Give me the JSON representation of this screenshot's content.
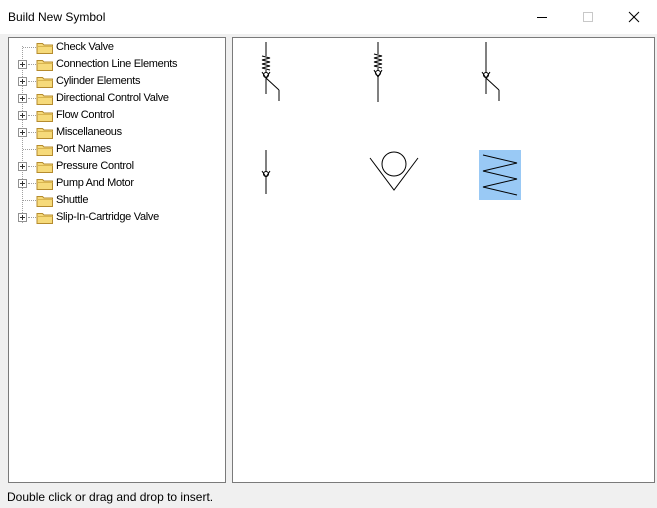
{
  "window": {
    "title": "Build New Symbol",
    "controls": [
      "minimize-icon",
      "maximize-icon",
      "close-icon"
    ]
  },
  "tree": {
    "items": [
      {
        "label": "Check Valve",
        "expandable": false
      },
      {
        "label": "Connection Line Elements",
        "expandable": true
      },
      {
        "label": "Cylinder Elements",
        "expandable": true
      },
      {
        "label": "Directional Control Valve",
        "expandable": true
      },
      {
        "label": "Flow Control",
        "expandable": true
      },
      {
        "label": "Miscellaneous",
        "expandable": true
      },
      {
        "label": "Port Names",
        "expandable": false
      },
      {
        "label": "Pressure Control",
        "expandable": true
      },
      {
        "label": "Pump And Motor",
        "expandable": true
      },
      {
        "label": "Shuttle",
        "expandable": false
      },
      {
        "label": "Slip-In-Cartridge Valve",
        "expandable": true
      }
    ]
  },
  "symbols": [
    {
      "name": "check-valve-spring-angled",
      "selected": false
    },
    {
      "name": "check-valve-spring-straight",
      "selected": false
    },
    {
      "name": "check-valve-angled",
      "selected": false
    },
    {
      "name": "check-valve-simple",
      "selected": false
    },
    {
      "name": "check-valve-ball-seat",
      "selected": false
    },
    {
      "name": "spring",
      "selected": true
    }
  ],
  "colors": {
    "selection": "#99c9f5",
    "folder": "#e8c35a"
  },
  "status": {
    "text": "Double click or drag and drop to insert."
  }
}
